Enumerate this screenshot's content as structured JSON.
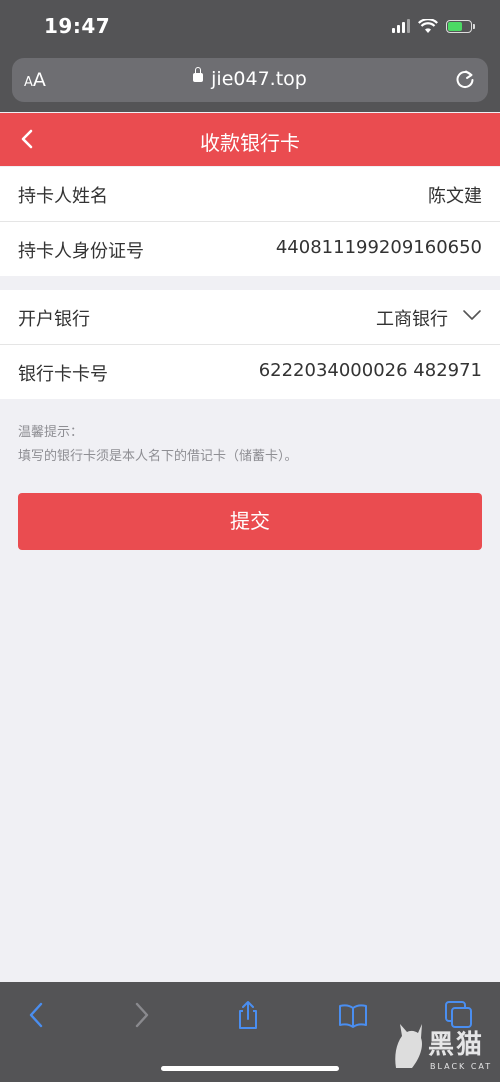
{
  "status_bar": {
    "time": "19:47"
  },
  "browser": {
    "aa_label_small": "A",
    "aa_label_large": "A",
    "url": "jie047.top"
  },
  "header": {
    "title": "收款银行卡"
  },
  "card_holder": {
    "name_label": "持卡人姓名",
    "name_value": "陈文建",
    "id_label": "持卡人身份证号",
    "id_value": "440811199209160650"
  },
  "bank": {
    "bank_label": "开户银行",
    "bank_value": "工商银行",
    "card_label": "银行卡卡号",
    "card_value": "6222034000026 482971"
  },
  "tips": {
    "title": "温馨提示：",
    "text": "填写的银行卡须是本人名下的借记卡（储蓄卡）。"
  },
  "submit_label": "提交",
  "watermark": {
    "cn": "黑猫",
    "en": "BLACK CAT"
  },
  "colors": {
    "accent": "#ea4c50",
    "chrome": "#545456",
    "toolbar_icon": "#4a8ef0"
  }
}
